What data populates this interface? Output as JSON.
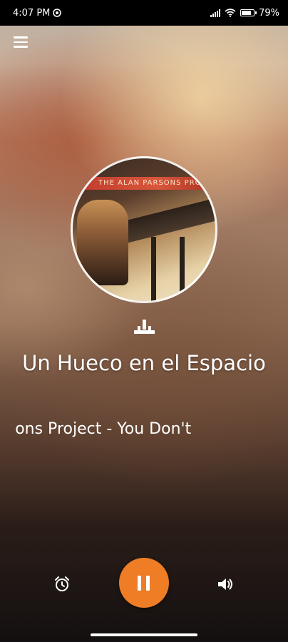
{
  "status_bar": {
    "time": "4:07 PM",
    "battery_percent": "79",
    "battery_level": 0.79,
    "icons": [
      "sync-icon",
      "signal-icon",
      "wifi-icon",
      "battery-icon"
    ]
  },
  "header": {
    "menu_icon": "hamburger-menu-icon"
  },
  "album_art": {
    "band_text": "THE ALAN PARSONS PROJECT"
  },
  "now_playing": {
    "title": "Un Hueco en el Espacio",
    "subtitle": "n Parsons Project - You Don't"
  },
  "controls": {
    "alarm_icon": "alarm-clock-icon",
    "play_pause_icon": "pause-icon",
    "volume_icon": "volume-icon",
    "accent_color": "#ee7d26"
  }
}
